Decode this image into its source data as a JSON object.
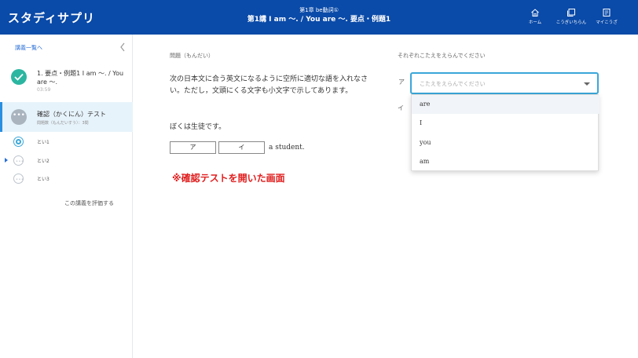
{
  "header": {
    "logo": "スタディサプリ",
    "chapter": "第1章 be動詞①",
    "lesson": "第1講 I am ～. / You are ～. 要点・例題1",
    "nav": [
      {
        "label": "ホーム",
        "icon": "home-icon"
      },
      {
        "label": "こうぎいちらん",
        "icon": "lecture-list-icon"
      },
      {
        "label": "マイこうざ",
        "icon": "my-course-icon"
      }
    ]
  },
  "sidebar": {
    "back": "講義一覧へ",
    "lesson": {
      "title": "1. 要点・例題1 I am ～. / You are ～.",
      "time": "03:59"
    },
    "test": {
      "title": "確認（かくにん）テスト",
      "sub": "問題数（もんだいすう）：3問"
    },
    "questions": [
      "とい1",
      "とい2",
      "とい3"
    ],
    "rate": "この講義を評価する"
  },
  "main": {
    "question_head": "問題（もんだい）",
    "instruction": "次の日本文に合う英文になるように空所に適切な語を入れなさい。ただし，文頭にくる文字も小文字で示してあります。",
    "sentence": "ぼくは生徒です。",
    "blank_a": "ア",
    "blank_i": "イ",
    "after_blanks": "a student.",
    "annotation": "※確認テストを開いた画面"
  },
  "answer": {
    "head": "それぞれこたえをえらんでください",
    "label_a": "ア",
    "label_i": "イ",
    "placeholder": "こたえをえらんでください",
    "options": [
      "are",
      "I",
      "you",
      "am"
    ]
  },
  "colors": {
    "header": "#0a4aa8",
    "accent": "#3aa7d9",
    "check": "#2bb6a1",
    "annotation": "#e02020"
  }
}
